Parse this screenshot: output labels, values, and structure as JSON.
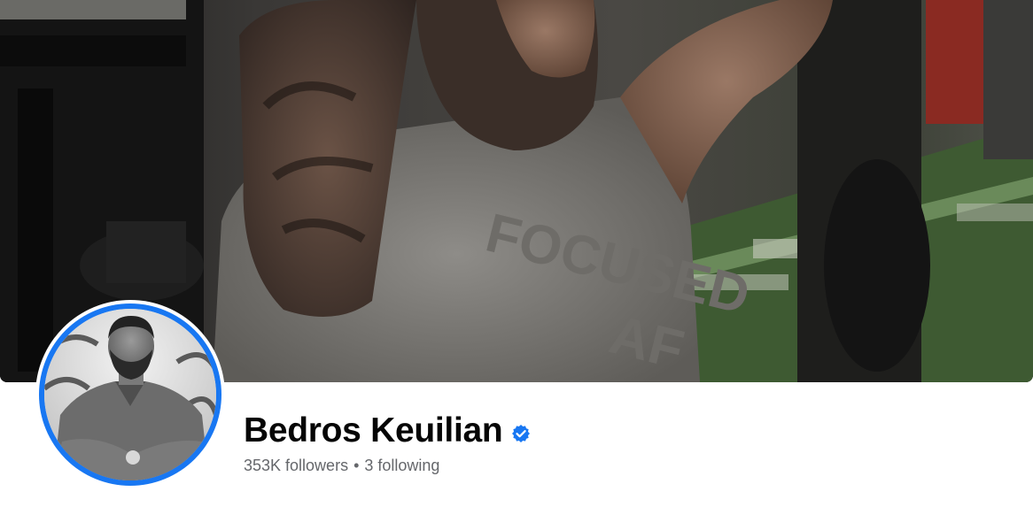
{
  "profile": {
    "name": "Bedros Keuilian",
    "verified_icon": "verified-badge-icon",
    "followers_label": "353K followers",
    "separator": "•",
    "following_label": "3 following"
  },
  "cover": {
    "shirt_text_line1": "FOCUSED",
    "shirt_text_line2": "AF"
  },
  "colors": {
    "accent": "#1877f2",
    "name_text": "#050505",
    "secondary_text": "#65676b"
  }
}
